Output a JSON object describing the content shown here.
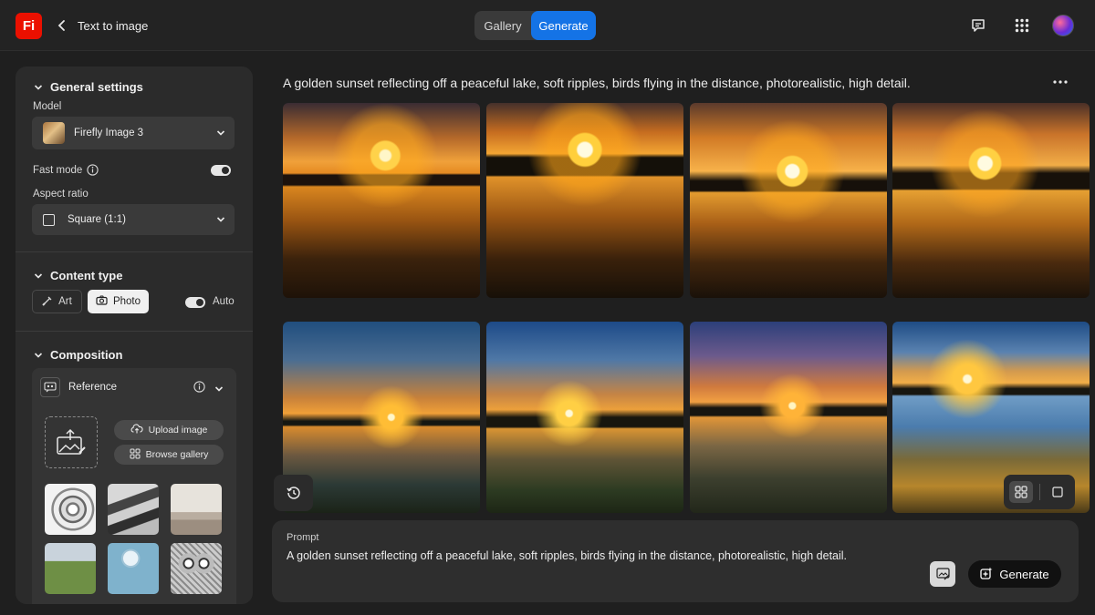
{
  "app": {
    "logo_text": "Fi",
    "title": "Text to image",
    "brand_color": "#eb1000"
  },
  "top_switcher": {
    "gallery_label": "Gallery",
    "generate_label": "Generate",
    "active": "Generate",
    "active_color": "#1473e6"
  },
  "top_icons": [
    "feedback-icon",
    "apps-grid-icon",
    "avatar"
  ],
  "sidebar": {
    "general": {
      "title": "General settings",
      "model_label": "Model",
      "model_value": "Firefly Image 3",
      "fast_mode_label": "Fast mode",
      "fast_mode_on": true,
      "aspect_label": "Aspect ratio",
      "aspect_value": "Square (1:1)"
    },
    "content_type": {
      "title": "Content type",
      "art_label": "Art",
      "photo_label": "Photo",
      "selected": "Photo",
      "auto_label": "Auto",
      "auto_on": true
    },
    "composition": {
      "title": "Composition",
      "reference_label": "Reference",
      "upload_label": "Upload image",
      "browse_label": "Browse gallery",
      "thumbnails": [
        "sketch-swirl",
        "road-landscape",
        "interior-room",
        "green-field",
        "sphere-pedestal",
        "owl-sketch"
      ]
    }
  },
  "main": {
    "prompt_heading": "A golden sunset reflecting off a peaceful lake, soft ripples, birds flying in the distance, photorealistic, high detail.",
    "images": [
      "sunset-lake-1",
      "sunset-lake-2",
      "sunset-lake-3",
      "sunset-lake-4",
      "sunset-lake-5",
      "sunset-lake-6",
      "sunset-lake-7",
      "sunset-lake-8"
    ]
  },
  "prompt_box": {
    "label": "Prompt",
    "text": "A golden sunset reflecting off a peaceful lake, soft ripples, birds flying in the distance, photorealistic, high detail.",
    "generate_label": "Generate"
  }
}
